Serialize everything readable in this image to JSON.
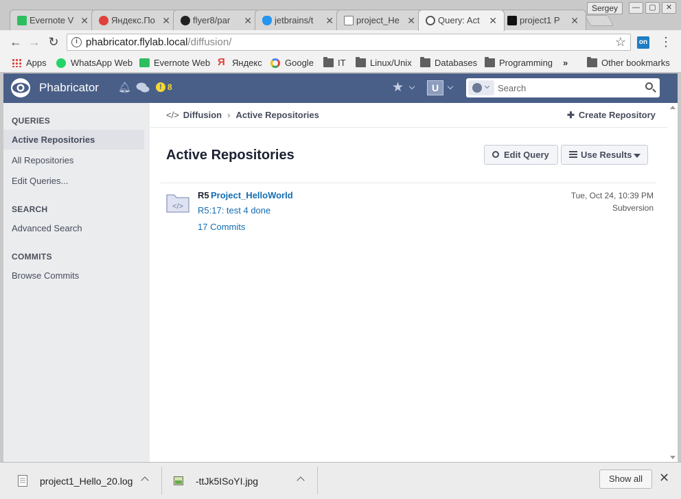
{
  "browser": {
    "tabs": [
      {
        "title": "Evernote V",
        "favicon": "evernote-icon",
        "color": "#2dbe60"
      },
      {
        "title": "Яндекс.По",
        "favicon": "yandex-icon",
        "color": "#e0413b"
      },
      {
        "title": "flyer8/par",
        "favicon": "github-icon",
        "color": "#222222"
      },
      {
        "title": "jetbrains/t",
        "favicon": "docker-icon",
        "color": "#2496ed"
      },
      {
        "title": "project_He",
        "favicon": "document-icon",
        "color": "#777777"
      },
      {
        "title": "Query: Act",
        "favicon": "phabricator-icon",
        "color": "#555555",
        "active": true
      },
      {
        "title": "project1 P",
        "favicon": "teamcity-icon",
        "color": "#111111"
      }
    ],
    "user_name": "Sergey",
    "address": {
      "host": "phabricator.flylab.local",
      "path": "/diffusion/"
    },
    "extension_label": "on",
    "bookmarks": [
      {
        "label": "Apps",
        "icon": "apps-grid-icon"
      },
      {
        "label": "WhatsApp Web",
        "icon": "whatsapp-icon",
        "color": "#25d366"
      },
      {
        "label": "Evernote Web",
        "icon": "evernote-icon",
        "color": "#2dbe60"
      },
      {
        "label": "Яндекс",
        "icon": "yandex-icon",
        "color": "#e0413b"
      },
      {
        "label": "Google",
        "icon": "google-icon",
        "color": "#4285f4"
      },
      {
        "label": "IT",
        "icon": "folder-icon"
      },
      {
        "label": "Linux/Unix",
        "icon": "folder-icon"
      },
      {
        "label": "Databases",
        "icon": "folder-icon"
      },
      {
        "label": "Programming",
        "icon": "folder-icon"
      }
    ],
    "bookmarks_overflow": "»",
    "other_bookmarks": "Other bookmarks"
  },
  "phab": {
    "brand": "Phabricator",
    "alert_count": "8",
    "alert_symbol": "!",
    "user_initial": "U",
    "search_placeholder": "Search",
    "header_color": "#4a5f88"
  },
  "sidebar": {
    "sections": [
      {
        "heading": "QUERIES",
        "items": [
          "Active Repositories",
          "All Repositories",
          "Edit Queries..."
        ]
      },
      {
        "heading": "SEARCH",
        "items": [
          "Advanced Search"
        ]
      },
      {
        "heading": "COMMITS",
        "items": [
          "Browse Commits"
        ]
      }
    ]
  },
  "crumbs": {
    "app": "Diffusion",
    "separator": "›",
    "current": "Active Repositories"
  },
  "create_label": "Create Repository",
  "page_title": "Active Repositories",
  "buttons": {
    "edit_query": "Edit Query",
    "use_results": "Use Results"
  },
  "repo": {
    "monogram": "R5",
    "name": "Project_HelloWorld",
    "latest_commit": "R5:17: test 4 done",
    "commits": "17 Commits",
    "date": "Tue, Oct 24, 10:39 PM",
    "vcs": "Subversion"
  },
  "downloads": {
    "items": [
      {
        "name": "project1_Hello_20.log",
        "icon": "text-file-icon"
      },
      {
        "name": "-ttJk5ISoYI.jpg",
        "icon": "image-file-icon"
      }
    ],
    "show_all": "Show all",
    "close_symbol": "✕"
  }
}
